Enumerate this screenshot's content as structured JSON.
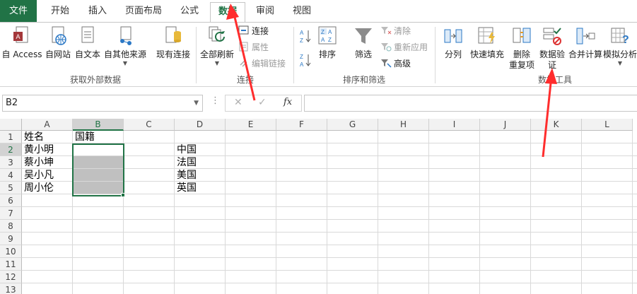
{
  "tabs": [
    {
      "label": "文件"
    },
    {
      "label": "开始"
    },
    {
      "label": "插入"
    },
    {
      "label": "页面布局"
    },
    {
      "label": "公式"
    },
    {
      "label": "数据",
      "active": true
    },
    {
      "label": "审阅"
    },
    {
      "label": "视图"
    }
  ],
  "ribbon": {
    "external": {
      "group_label": "获取外部数据",
      "access": "自 Access",
      "web": "自网站",
      "text": "自文本",
      "other": "自其他来源",
      "existing": "现有连接"
    },
    "connections": {
      "group_label": "连接",
      "refresh_all": "全部刷新",
      "connections": "连接",
      "properties": "属性",
      "edit_links": "编辑链接"
    },
    "sort_filter": {
      "group_label": "排序和筛选",
      "sort": "排序",
      "filter": "筛选",
      "clear": "清除",
      "reapply": "重新应用",
      "advanced": "高级"
    },
    "tools": {
      "group_label": "数据工具",
      "text_to_columns": "分列",
      "flash_fill": "快速填充",
      "remove_dup_1": "删除",
      "remove_dup_2": "重复项",
      "validation_1": "数据验",
      "validation_2": "证",
      "consolidate": "合并计算",
      "what_if": "模拟分析"
    }
  },
  "formula_bar": {
    "name_box": "B2",
    "fx": "fx",
    "value": ""
  },
  "sheet": {
    "columns": [
      "A",
      "B",
      "C",
      "D",
      "E",
      "F",
      "G",
      "H",
      "I",
      "J",
      "K",
      "L"
    ],
    "rows": [
      "1",
      "2",
      "3",
      "4",
      "5",
      "6",
      "7",
      "8",
      "9",
      "10",
      "11",
      "12",
      "13"
    ],
    "selected_cell": "B2",
    "cells": {
      "A1": "姓名",
      "B1": "国籍",
      "A2": "黄小明",
      "A3": "蔡小坤",
      "A4": "吴小凡",
      "A5": "周小伦",
      "D2": "中国",
      "D3": "法国",
      "D4": "美国",
      "D5": "英国"
    }
  },
  "colors": {
    "accent": "#217346",
    "annotation": "#ff2d2d",
    "shaded_cells": "#c0c0c0"
  }
}
